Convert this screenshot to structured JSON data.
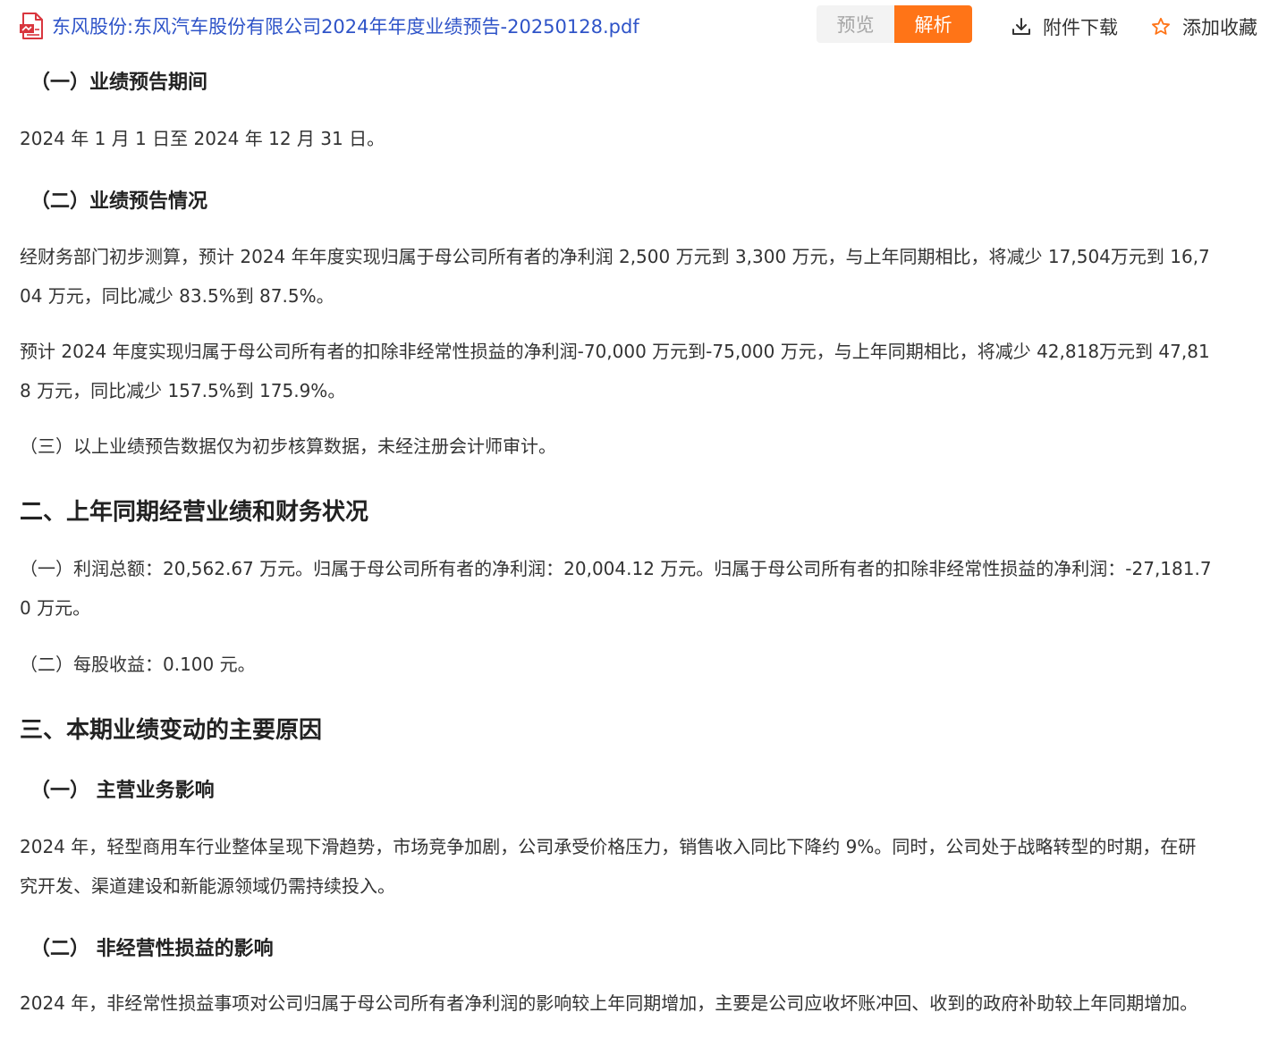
{
  "toolbar": {
    "file_name": "东风股份:东风汽车股份有限公司2024年年度业绩预告-20250128.pdf",
    "file_icon": "pdf-file-icon",
    "preview_label": "预览",
    "parse_label": "解析",
    "download_label": "附件下载",
    "favorite_label": "添加收藏",
    "accent_color": "#ff7417",
    "link_color": "#2f54c8"
  },
  "content": {
    "h_period": "（一）业绩预告期间",
    "p_period": "2024 年 1 月 1 日至 2024 年 12 月 31 日。",
    "h_forecast": "（二）业绩预告情况",
    "p_forecast1_l1": "经财务部门初步测算，预计 2024  年年度实现归属于母公司所有者的净利润 2,500 万元到 3,300 万元，与上年同期相比，将减少 17,504万元到 16,7",
    "p_forecast1_l2": "04 万元，同比减少 83.5%到 87.5%。",
    "p_forecast2_l1": "预计 2024  年度实现归属于母公司所有者的扣除非经常性损益的净利润-70,000 万元到-75,000 万元，与上年同期相比，将减少 42,818万元到 47,81",
    "p_forecast2_l2": "8 万元，同比减少 157.5%到 175.9%。",
    "p_note": "（三）以上业绩预告数据仅为初步核算数据，未经注册会计师审计。",
    "h2_prior": "二、上年同期经营业绩和财务状况",
    "p_prior1_l1": "（一）利润总额：20,562.67 万元。归属于母公司所有者的净利润：20,004.12 万元。归属于母公司所有者的扣除非经常性损益的净利润：-27,181.7",
    "p_prior1_l2": "0 万元。",
    "p_prior2": "（二）每股收益：0.100 元。",
    "h2_reasons": "三、本期业绩变动的主要原因",
    "h_main": "（一） 主营业务影响",
    "p_main_l1": "2024 年，轻型商用车行业整体呈现下滑趋势，市场竞争加剧，公司承受价格压力，销售收入同比下降约 9%。同时，公司处于战略转型的时期，在研",
    "p_main_l2": "究开发、渠道建设和新能源领域仍需持续投入。",
    "h_nonrec": "（二） 非经营性损益的影响",
    "p_nonrec": "2024 年，非经常性损益事项对公司归属于母公司所有者净利润的影响较上年同期增加，主要是公司应收坏账冲回、收到的政府补助较上年同期增加。"
  }
}
